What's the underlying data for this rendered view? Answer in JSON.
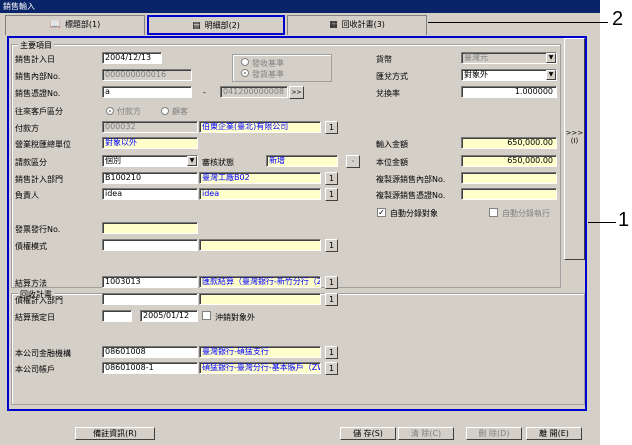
{
  "window": {
    "title": "銷售輸入"
  },
  "tabs": [
    {
      "label": "標題部(1)",
      "icon": "book-icon"
    },
    {
      "label": "明細部(2)",
      "icon": "document-icon"
    },
    {
      "label": "回收計畫(3)",
      "icon": "calendar-icon"
    }
  ],
  "main": {
    "group_title": "主要項目",
    "sales_date_label": "銷售計入日",
    "sales_date": "2004/12/13",
    "internal_no_label": "銷售內部No.",
    "internal_no": "000000000016",
    "voucher_no_label": "銷售憑證No.",
    "voucher_no": "a",
    "voucher_no_suffix": "041200000008",
    "basis_options": [
      "發收基準",
      "發貨基準"
    ],
    "partner_type_label": "往來客戶區分",
    "partner_type_options": [
      "付款方",
      "顧客"
    ],
    "payer_label": "付款方",
    "payer_code": "000032",
    "payer_name": "伯東企業(臺北)有限公司",
    "tax_unit_label": "營業稅匯總單位",
    "tax_unit": "對象以外",
    "request_type_label": "請款區分",
    "request_type": "個別",
    "approval_label": "審核狀態",
    "approval": "新增",
    "dept_label": "銷售計入部門",
    "dept_code": "B100210",
    "dept_name": "臺灣工廠B02",
    "person_label": "負責人",
    "person_code": "idea",
    "person_name": "idea",
    "invoice_no_label": "發票發行No.",
    "credit_label": "債權模式",
    "currency_label": "貨幣",
    "currency": "臺灣元",
    "exchange_label": "匯兌方式",
    "exchange": "對象外",
    "rate_label": "兌換率",
    "rate": "1.000000",
    "input_amount_label": "輸入金額",
    "input_amount": "650,000.00",
    "local_amount_label": "本位金額",
    "local_amount": "650,000.00",
    "copy_internal_label": "複製源銷售內部No.",
    "copy_voucher_label": "複製源銷售憑證No.",
    "auto_split_label": "自動分錄對象",
    "auto_split_exec_label": "自動分錄執行",
    "side_label": ">>> (I)"
  },
  "collect": {
    "group_title": "回收計畫",
    "method_label": "結算方法",
    "method_code": "1003013",
    "method_name": "匯款結算（臺灣銀行-新竹分行（ZWD）",
    "dept_label": "債權計入部門",
    "due_label": "結算預定日",
    "due_date": "2005/01/12",
    "offset_label": "沖銷對象外",
    "bank_label": "本公司金融機構",
    "bank_code": "08601008",
    "bank_name": "臺灣銀行-碩猛支行",
    "account_label": "本公司帳戶",
    "account_code": "08601008-1",
    "account_name": "碩猛銀行-臺灣分行-基本賬戶（ZWD）"
  },
  "footer": {
    "memo": "備註資訊(R)",
    "save": "儲 存(S)",
    "clear": "清 除(C)",
    "delete": "刪 除(D)",
    "close": "離 開(E)"
  },
  "callouts": {
    "one": "1",
    "two": "2"
  }
}
